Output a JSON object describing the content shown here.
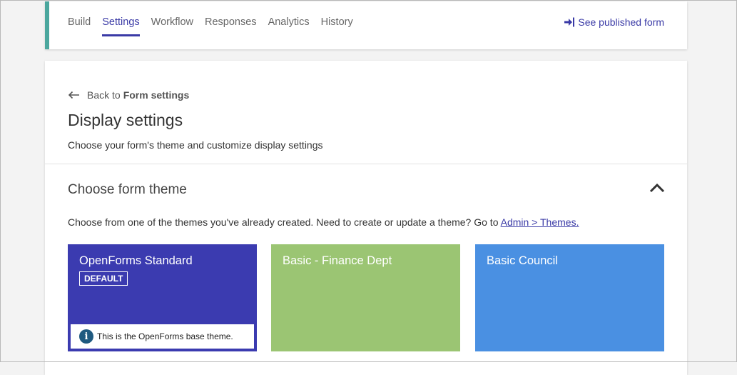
{
  "nav": {
    "tabs": [
      {
        "label": "Build",
        "active": false
      },
      {
        "label": "Settings",
        "active": true
      },
      {
        "label": "Workflow",
        "active": false
      },
      {
        "label": "Responses",
        "active": false
      },
      {
        "label": "Analytics",
        "active": false
      },
      {
        "label": "History",
        "active": false
      }
    ],
    "published_link": "See published form",
    "accent_color": "#4ba79e",
    "active_color": "#3a3aa6"
  },
  "page": {
    "back_prefix": "Back to",
    "back_target": "Form settings",
    "title": "Display settings",
    "subtitle": "Choose your form's theme and customize display settings"
  },
  "theme_section": {
    "title": "Choose form theme",
    "hint": "Choose from one of the themes you've already created. Need to create or update a theme? Go to",
    "hint_link": "Admin > Themes.",
    "themes": [
      {
        "name": "OpenForms Standard",
        "color": "#3b3bb0",
        "badge": "DEFAULT",
        "info": "This is the OpenForms base theme."
      },
      {
        "name": "Basic - Finance Dept",
        "color": "#9bc573"
      },
      {
        "name": "Basic Council",
        "color": "#4a90e2"
      }
    ]
  }
}
